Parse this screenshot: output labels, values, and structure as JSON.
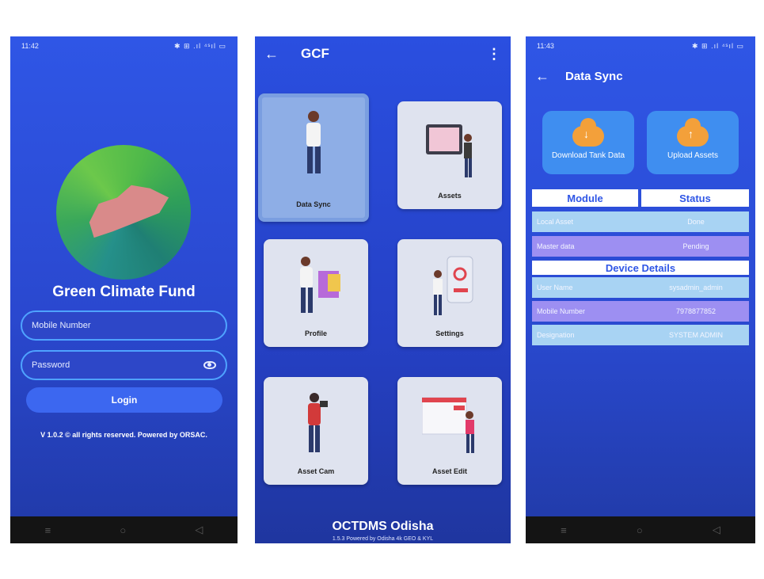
{
  "login": {
    "status_time": "11:42",
    "status_icons": "✱ ⊞ .ıl ⁴ˢıl ▭",
    "app_title": "Green Climate Fund",
    "mobile_placeholder": "Mobile Number",
    "password_placeholder": "Password",
    "login_label": "Login",
    "version": "V 1.0.2 © all rights reserved. Powered by ORSAC."
  },
  "home": {
    "title": "GCF",
    "tiles": [
      {
        "label": "Data Sync"
      },
      {
        "label": "Assets"
      },
      {
        "label": "Profile"
      },
      {
        "label": "Settings"
      },
      {
        "label": "Asset Cam"
      },
      {
        "label": "Asset Edit"
      }
    ],
    "footer_title": "OCTDMS Odisha",
    "footer_sub": "1.5.3 Powered by Odisha 4k GEO & KYL"
  },
  "datasync": {
    "status_time": "11:43",
    "status_icons": "✱ ⊞ .ıl ⁴ˢıl ▭",
    "title": "Data Sync",
    "download_label": "Download Tank Data",
    "upload_label": "Upload Assets",
    "col_module": "Module",
    "col_status": "Status",
    "rows": [
      {
        "module": "Local Asset",
        "status": "Done"
      },
      {
        "module": "Master data",
        "status": "Pending"
      }
    ],
    "device_header": "Device Details",
    "device_rows": [
      {
        "key": "User Name",
        "value": "sysadmin_admin"
      },
      {
        "key": "Mobile Number",
        "value": "7978877852"
      },
      {
        "key": "Designation",
        "value": "SYSTEM ADMIN"
      }
    ]
  }
}
